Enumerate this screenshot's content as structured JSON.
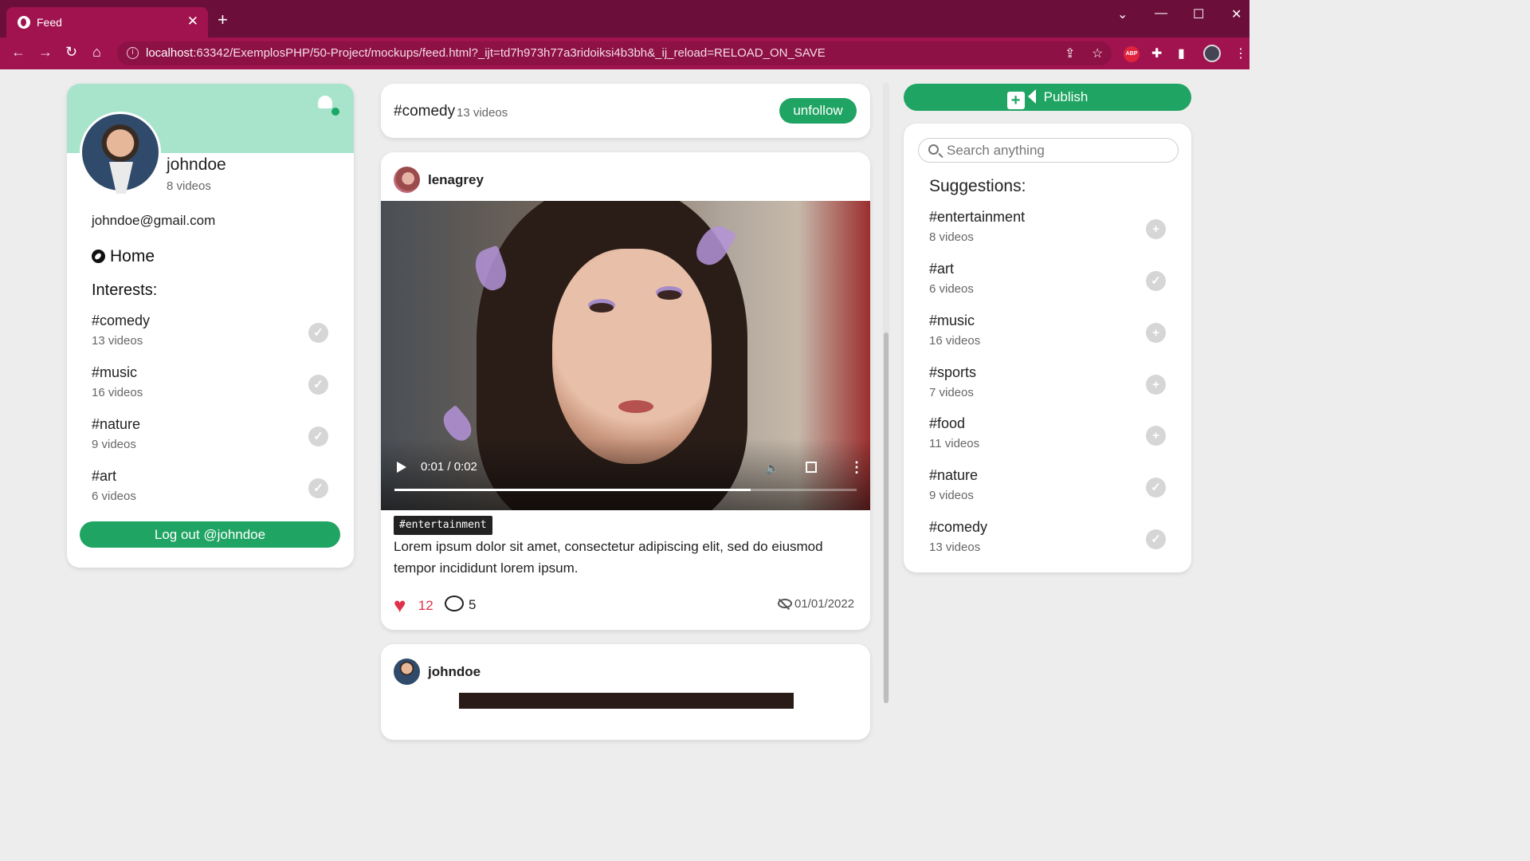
{
  "browser": {
    "tab_title": "Feed",
    "tab_close": "✕",
    "new_tab": "+",
    "url_host": "localhost",
    "url_rest": ":63342/ExemplosPHP/50-Project/mockups/feed.html?_ijt=td7h973h77a3ridoiksi4b3bh&_ij_reload=RELOAD_ON_SAVE",
    "abp_label": "ABP",
    "win_chevron": "⌄",
    "win_min": "—",
    "win_max": "☐",
    "win_close": "✕"
  },
  "profile": {
    "username": "johndoe",
    "video_count": "8 videos",
    "email": "johndoe@gmail.com",
    "home_label": "Home",
    "interests_title": "Interests:",
    "interests": [
      {
        "tag": "#comedy",
        "count": "13 videos",
        "icon": "check-icon"
      },
      {
        "tag": "#music",
        "count": "16 videos",
        "icon": "check-icon"
      },
      {
        "tag": "#nature",
        "count": "9 videos",
        "icon": "check-icon"
      },
      {
        "tag": "#art",
        "count": "6 videos",
        "icon": "check-icon"
      }
    ],
    "logout_label": "Log out @johndoe"
  },
  "topic": {
    "name": "#comedy",
    "count": "13 videos",
    "unfollow_label": "unfollow"
  },
  "post": {
    "author": "lenagrey",
    "video_time": "0:01 / 0:02",
    "video_progress": 0.77,
    "tag": "#entertainment",
    "text": "Lorem ipsum dolor sit amet, consectetur adipiscing elit, sed do eiusmod tempor incididunt lorem ipsum.",
    "likes": "12",
    "comments": "5",
    "date": "01/01/2022"
  },
  "post2": {
    "author": "johndoe"
  },
  "right": {
    "publish_label": "Publish",
    "search_placeholder": "Search anything",
    "suggestions_title": "Suggestions:",
    "suggestions": [
      {
        "tag": "#entertainment",
        "count": "8 videos",
        "icon": "plus-icon",
        "symbol": "+"
      },
      {
        "tag": "#art",
        "count": "6 videos",
        "icon": "check-icon",
        "symbol": "✓"
      },
      {
        "tag": "#music",
        "count": "16 videos",
        "icon": "plus-icon",
        "symbol": "+"
      },
      {
        "tag": "#sports",
        "count": "7 videos",
        "icon": "plus-icon",
        "symbol": "+"
      },
      {
        "tag": "#food",
        "count": "11 videos",
        "icon": "plus-icon",
        "symbol": "+"
      },
      {
        "tag": "#nature",
        "count": "9 videos",
        "icon": "check-icon",
        "symbol": "✓"
      },
      {
        "tag": "#comedy",
        "count": "13 videos",
        "icon": "check-icon",
        "symbol": "✓"
      }
    ]
  },
  "colors": {
    "brand_green": "#1fa463",
    "header_mint": "#a8e3cc",
    "browser_frame": "#6b0f3a",
    "browser_toolbar": "#a0134f",
    "like_red": "#e0314b"
  }
}
